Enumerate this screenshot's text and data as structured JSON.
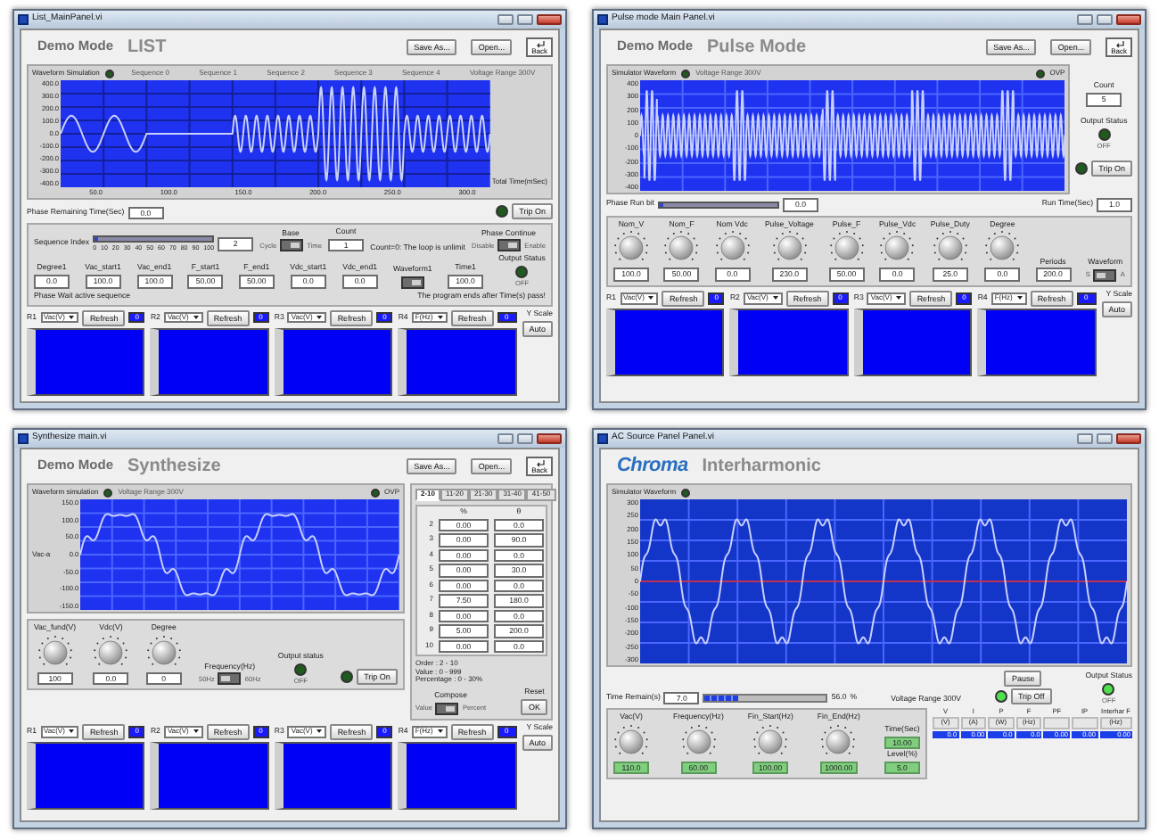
{
  "windows": [
    {
      "kind": "list",
      "title": "List_MainPanel.vi",
      "mode": "Demo Mode",
      "heading": "LIST",
      "buttons": [
        "Save As...",
        "Open..."
      ],
      "back": "Back",
      "chart": {
        "label": "Waveform Simulation",
        "led_on": false,
        "captions": [
          "Sequence 0",
          "Sequence 1",
          "Sequence 2",
          "Sequence 3",
          "Sequence 4",
          "Voltage Range 300V"
        ],
        "y_labels": [
          "400.0",
          "300.0",
          "200.0",
          "100.0",
          "0.0",
          "-100.0",
          "-200.0",
          "-300.0",
          "-400.0"
        ],
        "x_labels": [
          "50.0",
          "100.0",
          "150.0",
          "200.0",
          "250.0",
          "300.0"
        ],
        "x_title": "Total Time(mSec)"
      },
      "status": [
        {
          "kind": "readout",
          "label": "Phase Remaining Time(Sec)",
          "value": "0.0"
        },
        {
          "kind": "trip",
          "label": "Trip On",
          "on": false
        }
      ],
      "control_rows": [
        [
          {
            "kind": "slider",
            "label": "Sequence Index",
            "level": 0.02,
            "value": "2",
            "ticks": [
              "0",
              "10",
              "20",
              "30",
              "40",
              "50",
              "60",
              "70",
              "80",
              "90",
              "100"
            ]
          },
          {
            "kind": "switch",
            "label": "Base",
            "options": [
              "Cycle",
              "Time"
            ],
            "on": true
          },
          {
            "kind": "field",
            "label": "Count",
            "value": "1"
          },
          {
            "kind": "text",
            "text": "Count=0: The loop is unlimit"
          },
          {
            "kind": "switch",
            "label": "Phase Continue",
            "options": [
              "Disable",
              "Enable"
            ],
            "on": true
          }
        ],
        [
          {
            "kind": "field",
            "label": "Degree1",
            "value": "0.0"
          },
          {
            "kind": "field",
            "label": "Vac_start1",
            "value": "100.0"
          },
          {
            "kind": "field",
            "label": "Vac_end1",
            "value": "100.0"
          },
          {
            "kind": "field",
            "label": "F_start1",
            "value": "50.00"
          },
          {
            "kind": "field",
            "label": "F_end1",
            "value": "50.00"
          },
          {
            "kind": "field",
            "label": "Vdc_start1",
            "value": "0.0"
          },
          {
            "kind": "field",
            "label": "Vdc_end1",
            "value": "0.0"
          },
          {
            "kind": "switch",
            "label": "Waveform1",
            "on": true
          },
          {
            "kind": "field",
            "label": "Time1",
            "value": "100.0"
          },
          {
            "kind": "led",
            "label": "Output Status",
            "caption": "OFF",
            "on": false
          }
        ],
        [
          {
            "kind": "text",
            "text": "Phase Wait active sequence"
          },
          {
            "kind": "text",
            "text": "The program ends after Time(s) pass!"
          }
        ]
      ],
      "scopes": {
        "channels": [
          {
            "channel": "R1",
            "quantity": "Vac(V)",
            "refresh": "Refresh",
            "value": "0"
          },
          {
            "channel": "R2",
            "quantity": "Vac(V)",
            "refresh": "Refresh",
            "value": "0"
          },
          {
            "channel": "R3",
            "quantity": "Vac(V)",
            "refresh": "Refresh",
            "value": "0"
          },
          {
            "channel": "R4",
            "quantity": "F(Hz)",
            "refresh": "Refresh",
            "value": "0"
          }
        ],
        "y_scale": "Y Scale",
        "auto": "Auto"
      }
    },
    {
      "kind": "pulse",
      "title": "Pulse mode Main Panel.vi",
      "mode": "Demo Mode",
      "heading": "Pulse Mode",
      "buttons": [
        "Save As...",
        "Open..."
      ],
      "back": "Back",
      "chart": {
        "label": "Simulator Waveform",
        "led_on": false,
        "captions": [
          "Voltage Range 300V"
        ],
        "ovp": {
          "label": "OVP",
          "on": false
        },
        "y_labels": [
          "400",
          "300",
          "200",
          "100",
          "0",
          "-100",
          "-200",
          "-300",
          "-400"
        ]
      },
      "side": [
        {
          "kind": "field",
          "label": "Count",
          "value": "5"
        },
        {
          "kind": "led",
          "label": "Output Status",
          "caption": "OFF",
          "on": false
        },
        {
          "kind": "trip",
          "label": "Trip On",
          "on": false
        }
      ],
      "status": [
        {
          "kind": "slider",
          "label": "Phase Run bit",
          "level": 0.0,
          "value": "0.0"
        },
        {
          "kind": "readout",
          "label": "Run Time(Sec)",
          "value": "1.0"
        }
      ],
      "control_rows": [
        [
          {
            "kind": "knob",
            "label": "Nom_V",
            "value": "100.0"
          },
          {
            "kind": "knob",
            "label": "Nom_F",
            "value": "50.00"
          },
          {
            "kind": "knob",
            "label": "Nom Vdc",
            "value": "0.0"
          },
          {
            "kind": "knob",
            "label": "Pulse_Voltage",
            "value": "230.0"
          },
          {
            "kind": "knob",
            "label": "Pulse_F",
            "value": "50.00"
          },
          {
            "kind": "knob",
            "label": "Pulse_Vdc",
            "value": "0.0"
          },
          {
            "kind": "knob",
            "label": "Pulse_Duty",
            "value": "25.0"
          },
          {
            "kind": "knob",
            "label": "Degree",
            "value": "0.0"
          },
          {
            "kind": "field",
            "label": "Periods",
            "value": "200.0"
          },
          {
            "kind": "switch",
            "label": "Waveform",
            "options": [
              "S",
              "A"
            ],
            "on": false
          }
        ]
      ],
      "scopes": {
        "channels": [
          {
            "channel": "R1",
            "quantity": "Vac(V)",
            "refresh": "Refresh",
            "value": "0"
          },
          {
            "channel": "R2",
            "quantity": "Vac(V)",
            "refresh": "Refresh",
            "value": "0"
          },
          {
            "channel": "R3",
            "quantity": "Vac(V)",
            "refresh": "Refresh",
            "value": "0"
          },
          {
            "channel": "R4",
            "quantity": "F(Hz)",
            "refresh": "Refresh",
            "value": "0"
          }
        ],
        "y_scale": "Y Scale",
        "auto": "Auto"
      }
    },
    {
      "kind": "synthesize",
      "title": "Synthesize main.vi",
      "mode": "Demo Mode",
      "heading": "Synthesize",
      "buttons": [
        "Save As...",
        "Open..."
      ],
      "back": "Back",
      "chart": {
        "label": "Waveform simulation",
        "led_on": false,
        "captions": [
          "Voltage Range 300V"
        ],
        "ovp": {
          "label": "OVP",
          "on": false
        },
        "y_title": "Vac-a",
        "y_labels": [
          "150.0",
          "100.0",
          "50.0",
          "0.0",
          "-50.0",
          "-100.0",
          "-150.0"
        ]
      },
      "control_rows": [
        [
          {
            "kind": "knob",
            "label": "Vac_fund(V)",
            "value": "100"
          },
          {
            "kind": "knob",
            "label": "Vdc(V)",
            "value": "0.0"
          },
          {
            "kind": "knob",
            "label": "Degree",
            "value": "0"
          },
          {
            "kind": "switch",
            "label": "Frequency(Hz)",
            "options": [
              "50Hz",
              "60Hz"
            ],
            "on": false
          },
          {
            "kind": "led",
            "label": "Output status",
            "caption": "OFF",
            "on": false
          },
          {
            "kind": "trip",
            "label": "Trip On",
            "on": false
          }
        ]
      ],
      "harmonics": {
        "tabs": [
          {
            "label": "2-10",
            "selected": true
          },
          {
            "label": "11-20",
            "selected": false
          },
          {
            "label": "21-30",
            "selected": false
          },
          {
            "label": "31-40",
            "selected": false
          },
          {
            "label": "41-50",
            "selected": false
          }
        ],
        "columns": [
          "%",
          "θ"
        ],
        "rows": [
          {
            "order": "2",
            "percent": "0.00",
            "degree": "0.0"
          },
          {
            "order": "3",
            "percent": "0.00",
            "degree": "90.0"
          },
          {
            "order": "4",
            "percent": "0.00",
            "degree": "0.0"
          },
          {
            "order": "5",
            "percent": "0.00",
            "degree": "30.0"
          },
          {
            "order": "6",
            "percent": "0.00",
            "degree": "0.0"
          },
          {
            "order": "7",
            "percent": "7.50",
            "degree": "180.0"
          },
          {
            "order": "8",
            "percent": "0.00",
            "degree": "0.0"
          },
          {
            "order": "9",
            "percent": "5.00",
            "degree": "200.0"
          },
          {
            "order": "10",
            "percent": "0.00",
            "degree": "0.0"
          }
        ],
        "info": [
          "Order : 2 - 10",
          "Value : 0 - 999",
          "Percentage : 0 - 30%"
        ],
        "controls": [
          {
            "kind": "switch",
            "label": "Compose",
            "options": [
              "Value",
              "Percent"
            ],
            "on": true
          },
          {
            "kind": "field_button",
            "label": "Reset",
            "button": "OK"
          }
        ]
      },
      "scopes": {
        "channels": [
          {
            "channel": "R1",
            "quantity": "Vac(V)",
            "refresh": "Refresh",
            "value": "0"
          },
          {
            "channel": "R2",
            "quantity": "Vac(V)",
            "refresh": "Refresh",
            "value": "0"
          },
          {
            "channel": "R3",
            "quantity": "Vac(V)",
            "refresh": "Refresh",
            "value": "0"
          },
          {
            "channel": "R4",
            "quantity": "F(Hz)",
            "refresh": "Refresh",
            "value": "0"
          }
        ],
        "y_scale": "Y Scale",
        "auto": "Auto"
      }
    },
    {
      "kind": "interharmonic",
      "title": "AC Source Panel Panel.vi",
      "logo": "Chroma",
      "heading": "Interharmonic",
      "chart": {
        "label": "Simulator Waveform",
        "led_on": false,
        "y_labels": [
          "300",
          "250",
          "200",
          "150",
          "100",
          "50",
          "0",
          "-50",
          "-100",
          "-150",
          "-200",
          "-250",
          "-300"
        ]
      },
      "status": [
        {
          "kind": "progress",
          "label": "Time Remain(s)",
          "value": "7.0",
          "level": 0.28,
          "reading": "56.0",
          "unit": "%"
        },
        {
          "kind": "text",
          "text": "Voltage Range 300V"
        },
        {
          "kind": "pause_trip",
          "button": "Pause",
          "label": "Trip Off",
          "on": true
        },
        {
          "kind": "led",
          "label": "Output Status",
          "caption": "OFF",
          "on": true
        }
      ],
      "control_rows": [
        [
          {
            "kind": "knob",
            "label": "Vac(V)",
            "value": "110.0"
          },
          {
            "kind": "knob",
            "label": "Frequency(Hz)",
            "value": "60.00"
          },
          {
            "kind": "knob",
            "label": "Fin_Start(Hz)",
            "value": "100.00"
          },
          {
            "kind": "knob",
            "label": "Fin_End(Hz)",
            "value": "1000.00"
          },
          {
            "kind": "stack",
            "items": [
              {
                "kind": "field",
                "label": "Time(Sec)",
                "value": "10.00"
              },
              {
                "kind": "field",
                "label": "Level(%)",
                "value": "5.0"
              }
            ]
          }
        ]
      ],
      "data_table": {
        "columns": [
          {
            "header": "V",
            "unit": "(V)"
          },
          {
            "header": "I",
            "unit": "(A)"
          },
          {
            "header": "P",
            "unit": "(W)"
          },
          {
            "header": "F",
            "unit": "(Hz)"
          },
          {
            "header": "PF"
          },
          {
            "header": "IP"
          },
          {
            "header": "Interhar F",
            "unit": "(Hz)"
          }
        ],
        "rows": [
          {
            "selected": true,
            "values": [
              "0.0",
              "0.00",
              "0.0",
              "0.0",
              "0.00",
              "0.00",
              "0.00"
            ]
          }
        ]
      }
    }
  ]
}
